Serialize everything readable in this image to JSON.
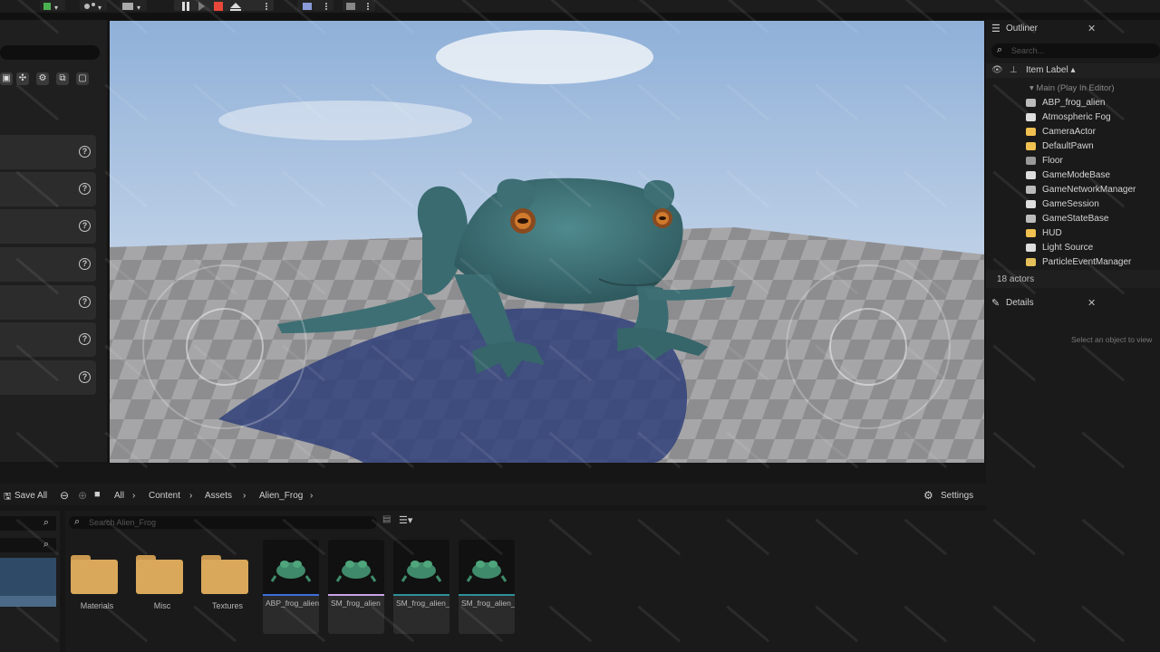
{
  "toolbar": {
    "icons": [
      "add-actor-icon",
      "blueprint-icon",
      "cinematics-icon",
      "pause-icon",
      "step-icon",
      "stop-icon",
      "eject-icon",
      "more-icon",
      "platforms-icon",
      "settings-icon"
    ],
    "stop_color": "#e8483b"
  },
  "left_panel": {
    "item_count": 7
  },
  "viewport": {
    "sky_top": "#8fb0d8",
    "sky_bottom": "#e6ecf3",
    "floor_color": "#8a8a8a",
    "shadow_color": "#30407a",
    "frog_color": "#3d6f74"
  },
  "outliner": {
    "title": "Outliner",
    "search_placeholder": "Search...",
    "column_label": "Item Label ▴",
    "root": "Main (Play In Editor)",
    "items": [
      {
        "label": "ABP_frog_alien",
        "icon": "actor-icon"
      },
      {
        "label": "Atmospheric Fog",
        "icon": "fog-icon"
      },
      {
        "label": "CameraActor",
        "icon": "camera-icon"
      },
      {
        "label": "DefaultPawn",
        "icon": "pawn-icon"
      },
      {
        "label": "Floor",
        "icon": "mesh-icon"
      },
      {
        "label": "GameModeBase",
        "icon": "gamemode-icon"
      },
      {
        "label": "GameNetworkManager",
        "icon": "network-icon"
      },
      {
        "label": "GameSession",
        "icon": "session-icon"
      },
      {
        "label": "GameStateBase",
        "icon": "gamestate-icon"
      },
      {
        "label": "HUD",
        "icon": "hud-icon"
      },
      {
        "label": "Light Source",
        "icon": "light-icon"
      },
      {
        "label": "ParticleEventManager",
        "icon": "particle-icon"
      }
    ],
    "count_label": "18 actors"
  },
  "details": {
    "title": "Details",
    "empty_text": "Select an object to view"
  },
  "content_browser": {
    "save_all": "Save All",
    "breadcrumbs": [
      "All",
      "Content",
      "Assets",
      "Alien_Frog"
    ],
    "settings": "Settings",
    "search_placeholder": "Search Alien_Frog",
    "folders": [
      "Materials",
      "Misc",
      "Textures"
    ],
    "assets": [
      {
        "name": "ABP_frog_alien",
        "strip": "#3c6dd8"
      },
      {
        "name": "SM_frog_alien",
        "strip": "#c9a3e8"
      },
      {
        "name": "SM_frog_alien_CtrlRig",
        "strip": "#2f8f9a"
      },
      {
        "name": "SM_frog_alien_PuppetRig",
        "strip": "#2f8f9a"
      }
    ]
  }
}
